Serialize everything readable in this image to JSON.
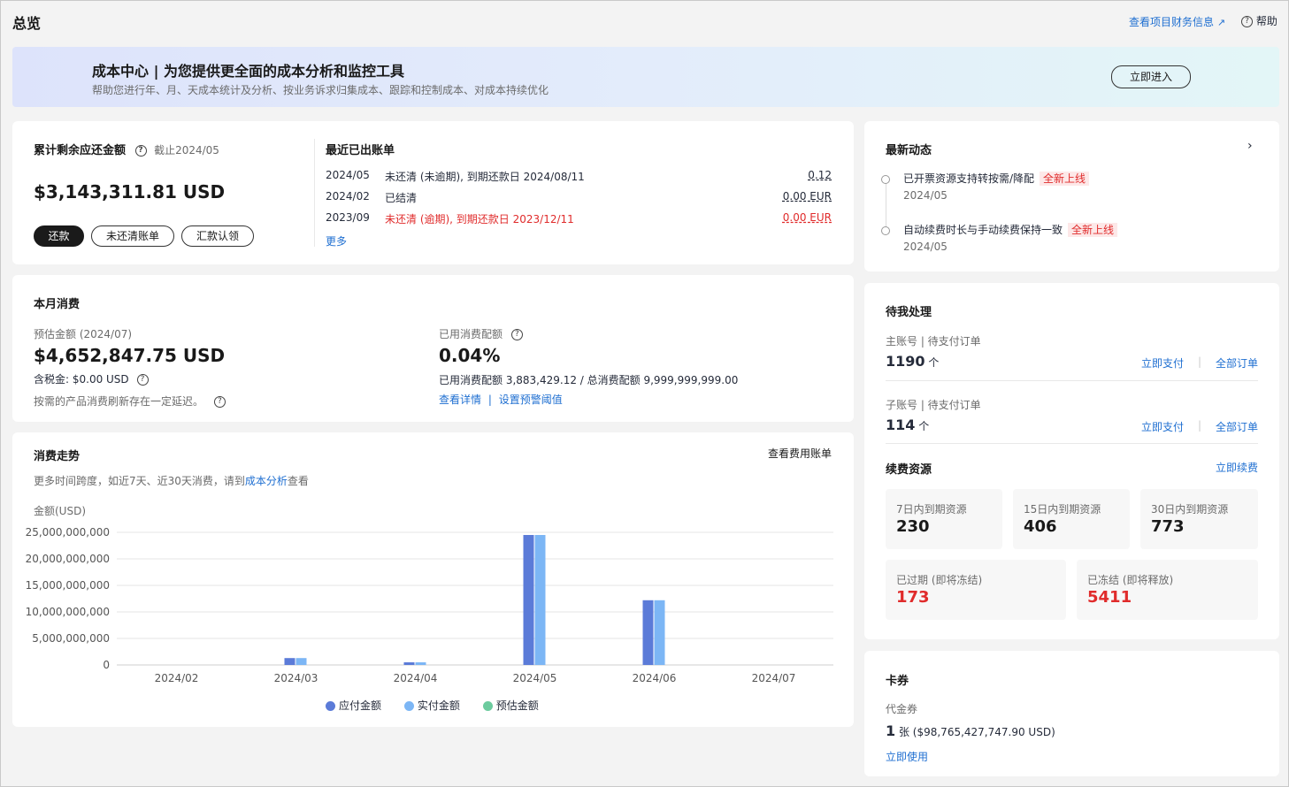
{
  "page": {
    "title": "总览",
    "finance_link": "查看项目财务信息",
    "help_label": "帮助"
  },
  "banner": {
    "title": "成本中心 | 为您提供更全面的成本分析和监控工具",
    "subtitle": "帮助您进行年、月、天成本统计及分析、按业务诉求归集成本、跟踪和控制成本、对成本持续优化",
    "button": "立即进入"
  },
  "balance": {
    "title": "累计剩余应还金额",
    "as_of": "截止2024/05",
    "amount": "$3,143,311.81 USD",
    "buttons": {
      "repay": "还款",
      "unpaid": "未还清账单",
      "remit": "汇款认领"
    }
  },
  "bills": {
    "title": "最近已出账单",
    "rows": [
      {
        "month": "2024/05",
        "desc": "未还清 (未逾期), 到期还款日 2024/08/11",
        "amount": "0.12",
        "status_color": "#252b3a"
      },
      {
        "month": "2024/02",
        "desc": "已结清",
        "amount": "0.00 EUR",
        "status_color": "#252b3a"
      },
      {
        "month": "2023/09",
        "desc": "未还清 (逾期), 到期还款日 2023/12/11",
        "amount": "0.00 EUR",
        "status_color": "#e02b2b"
      }
    ],
    "more": "更多"
  },
  "news": {
    "title": "最新动态",
    "items": [
      {
        "text": "已开票资源支持转按需/降配",
        "tag": "全新上线",
        "date": "2024/05"
      },
      {
        "text": "自动续费时长与手动续费保持一致",
        "tag": "全新上线",
        "date": "2024/05"
      }
    ]
  },
  "monthly": {
    "title": "本月消费",
    "est_label": "预估金额 (2024/07)",
    "est_amount": "$4,652,847.75 USD",
    "tax_label": "含税金: $0.00 USD",
    "delay_note": "按需的产品消费刷新存在一定延迟。",
    "quota_label": "已用消费配额",
    "quota_percent": "0.04%",
    "quota_detail": "已用消费配额 3,883,429.12 / 总消费配额 9,999,999,999.00",
    "view_detail": "查看详情",
    "set_alert": "设置预警阈值"
  },
  "trend": {
    "title": "消费走势",
    "bill_link": "查看费用账单",
    "note_prefix": "更多时间跨度，如近7天、近30天消费，请到",
    "note_link": "成本分析",
    "note_suffix": "查看"
  },
  "chart_data": {
    "type": "bar",
    "ylabel": "金额(USD)",
    "categories": [
      "2024/02",
      "2024/03",
      "2024/04",
      "2024/05",
      "2024/06",
      "2024/07"
    ],
    "ylim": [
      0,
      25000000000
    ],
    "yticks": [
      "25,000,000,000",
      "20,000,000,000",
      "15,000,000,000",
      "10,000,000,000",
      "5,000,000,000",
      "0"
    ],
    "ytick_values": [
      25000000000,
      20000000000,
      15000000000,
      10000000000,
      5000000000,
      0
    ],
    "grid": true,
    "legend_position": "bottom",
    "series": [
      {
        "name": "应付金额",
        "color": "#5b7bd8",
        "values": [
          0,
          1300000000,
          500000000,
          24500000000,
          12200000000,
          0
        ]
      },
      {
        "name": "实付金额",
        "color": "#7cb6f5",
        "values": [
          0,
          1300000000,
          500000000,
          24500000000,
          12200000000,
          0
        ]
      },
      {
        "name": "预估金额",
        "color": "#6ccb9e",
        "values": [
          0,
          0,
          0,
          0,
          0,
          0
        ]
      }
    ]
  },
  "pending": {
    "title": "待我处理",
    "main": {
      "label": "主账号 | 待支付订单",
      "count": "1190",
      "unit": "个",
      "pay": "立即支付",
      "all": "全部订单"
    },
    "sub": {
      "label": "子账号 | 待支付订单",
      "count": "114",
      "unit": "个",
      "pay": "立即支付",
      "all": "全部订单"
    },
    "renew_title": "续费资源",
    "renew_link": "立即续费",
    "stats": [
      {
        "label": "7日内到期资源",
        "value": "230"
      },
      {
        "label": "15日内到期资源",
        "value": "406"
      },
      {
        "label": "30日内到期资源",
        "value": "773"
      }
    ],
    "stats2": [
      {
        "label": "已过期 (即将冻结)",
        "value": "173"
      },
      {
        "label": "已冻结 (即将释放)",
        "value": "5411"
      }
    ]
  },
  "coupons": {
    "title": "卡券",
    "label": "代金券",
    "count": "1",
    "detail": "张 ($98,765,427,747.90 USD)",
    "use": "立即使用"
  }
}
